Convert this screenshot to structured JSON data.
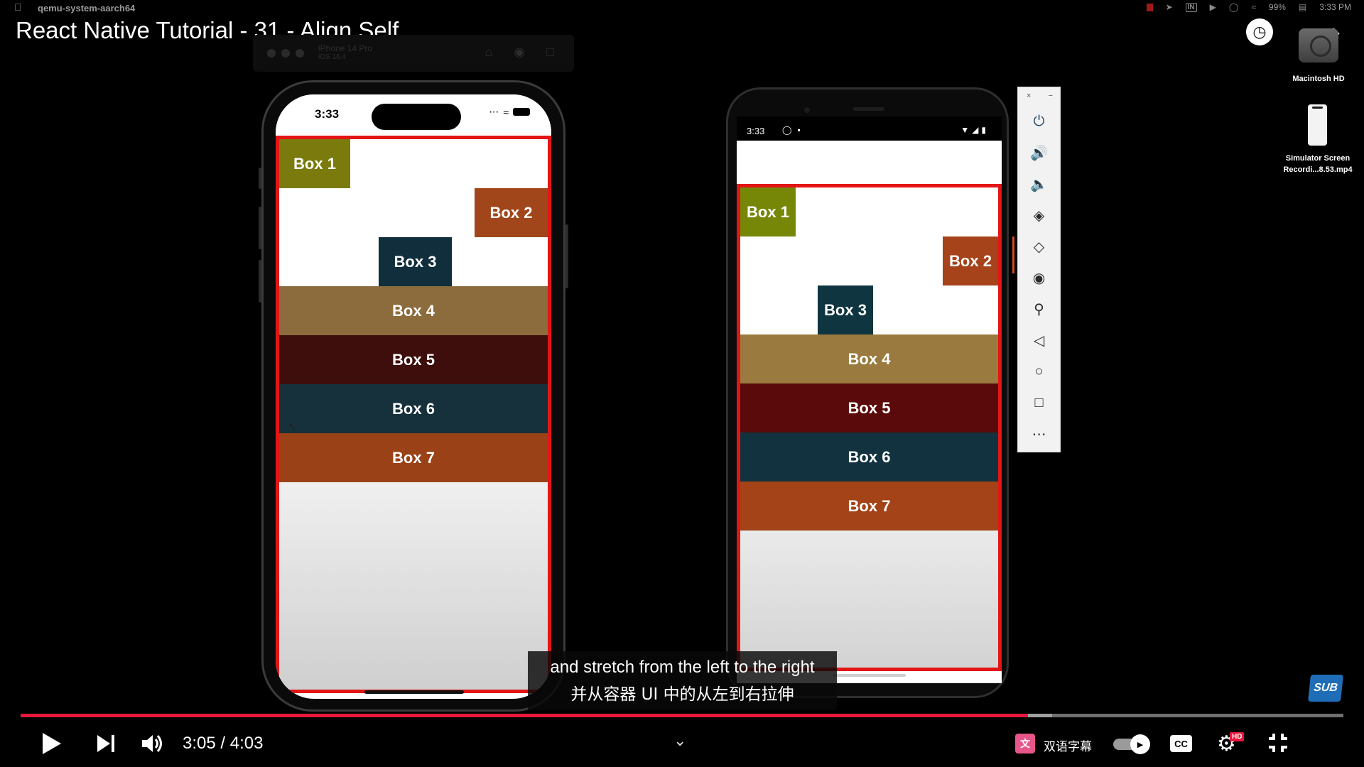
{
  "menubar": {
    "app_name": "qemu-system-aarch64",
    "battery": "99%",
    "time": "3:33 PM",
    "status_icons": [
      "record-icon",
      "location-icon",
      "input-icon",
      "play-icon",
      "user-icon",
      "wifi-icon",
      "battery-icon",
      "control-center-icon"
    ]
  },
  "video": {
    "title": "React Native Tutorial - 31 - Align Self",
    "current_time": "3:05",
    "duration": "4:03",
    "time_display": "3:05 / 4:03",
    "progress_fraction": 0.7613,
    "buffered_fraction": 0.78
  },
  "simulator_toolbar": {
    "device_name": "iPhone 14 Pro",
    "os": "iOS 16.4",
    "icons": [
      "home-icon",
      "screenshot-icon",
      "rotate-icon"
    ]
  },
  "iphone": {
    "status_time": "3:33",
    "boxes": [
      {
        "label": "Box 1",
        "color": "#7a7b0c",
        "align": "flex-start"
      },
      {
        "label": "Box 2",
        "color": "#a1461a",
        "align": "flex-end"
      },
      {
        "label": "Box 3",
        "color": "#102e3c",
        "align": "center"
      },
      {
        "label": "Box 4",
        "color": "#8c6c3c",
        "align": "stretch"
      },
      {
        "label": "Box 5",
        "color": "#3e0e0c",
        "align": "stretch"
      },
      {
        "label": "Box 6",
        "color": "#16303c",
        "align": "stretch"
      },
      {
        "label": "Box 7",
        "color": "#9a4118",
        "align": "stretch"
      }
    ]
  },
  "android": {
    "status_time": "3:33",
    "boxes": [
      {
        "label": "Box 1",
        "color": "#768708"
      },
      {
        "label": "Box 2",
        "color": "#a6431a"
      },
      {
        "label": "Box 3",
        "color": "#0f3540"
      },
      {
        "label": "Box 4",
        "color": "#9a7a3e"
      },
      {
        "label": "Box 5",
        "color": "#5a0a0a"
      },
      {
        "label": "Box 6",
        "color": "#123240"
      },
      {
        "label": "Box 7",
        "color": "#a44218"
      }
    ]
  },
  "emulator_panel": {
    "close": "×",
    "minimize": "−",
    "icons": [
      "power-icon",
      "volume-up-icon",
      "volume-down-icon",
      "rotate-left-icon",
      "rotate-right-icon",
      "camera-icon",
      "zoom-icon",
      "back-icon",
      "home-icon",
      "overview-icon",
      "more-icon"
    ]
  },
  "desktop": {
    "items": [
      {
        "label": "Macintosh HD"
      },
      {
        "label_line1": "Simulator Screen",
        "label_line2": "Recordi...8.53.mp4"
      }
    ]
  },
  "subtitles": {
    "english": "and stretch from the left to the right",
    "chinese": "并从容器 UI 中的从左到右拉伸"
  },
  "player": {
    "translate_label": "双语字幕",
    "translate_icon": "文",
    "cc_label": "CC",
    "hd_label": "HD",
    "sub_badge": "SUB"
  },
  "colors": {
    "progress": "#e8173c",
    "frame_border": "#e31515"
  }
}
